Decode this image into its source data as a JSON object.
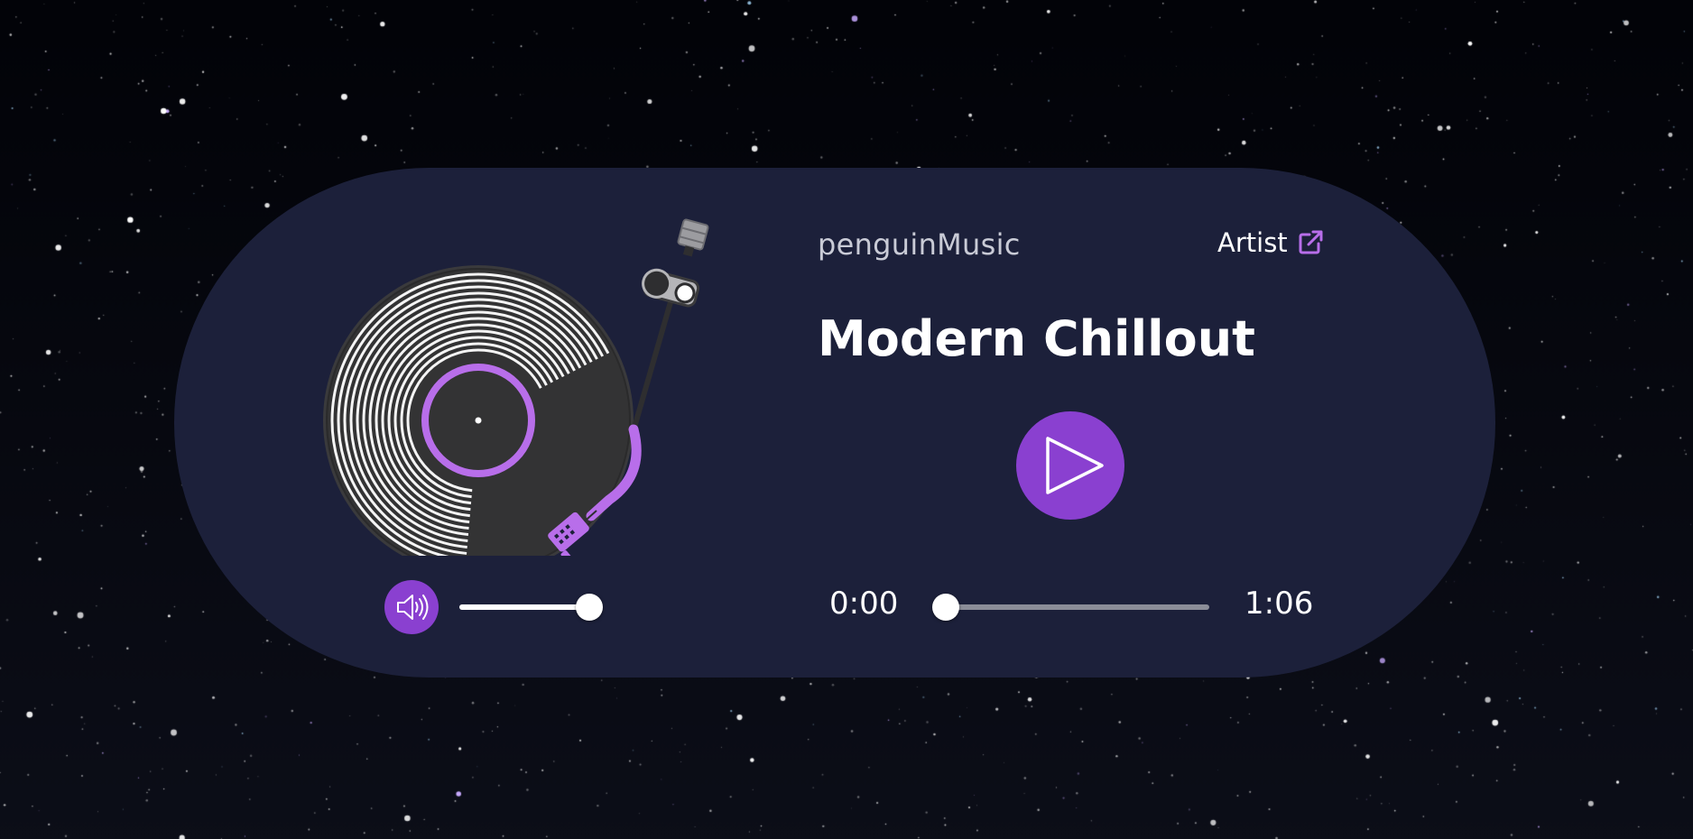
{
  "app": {
    "brand": "penguinMusic"
  },
  "track": {
    "title": "Modern Chillout",
    "artist_label": "Artist",
    "current_time": "0:00",
    "duration": "1:06",
    "progress_fraction": 0.0
  },
  "volume": {
    "level_fraction": 1.0
  },
  "icons": {
    "play": "play-icon",
    "volume": "speaker-volume-icon",
    "external_link": "external-link-icon",
    "turntable": "turntable-vinyl-icon"
  },
  "colors": {
    "background": "#05060b",
    "card": "#1c203a",
    "accent": "#8a40d0",
    "accent_light": "#b86eea",
    "text": "#ffffff",
    "muted_text": "#c9cbd6"
  }
}
